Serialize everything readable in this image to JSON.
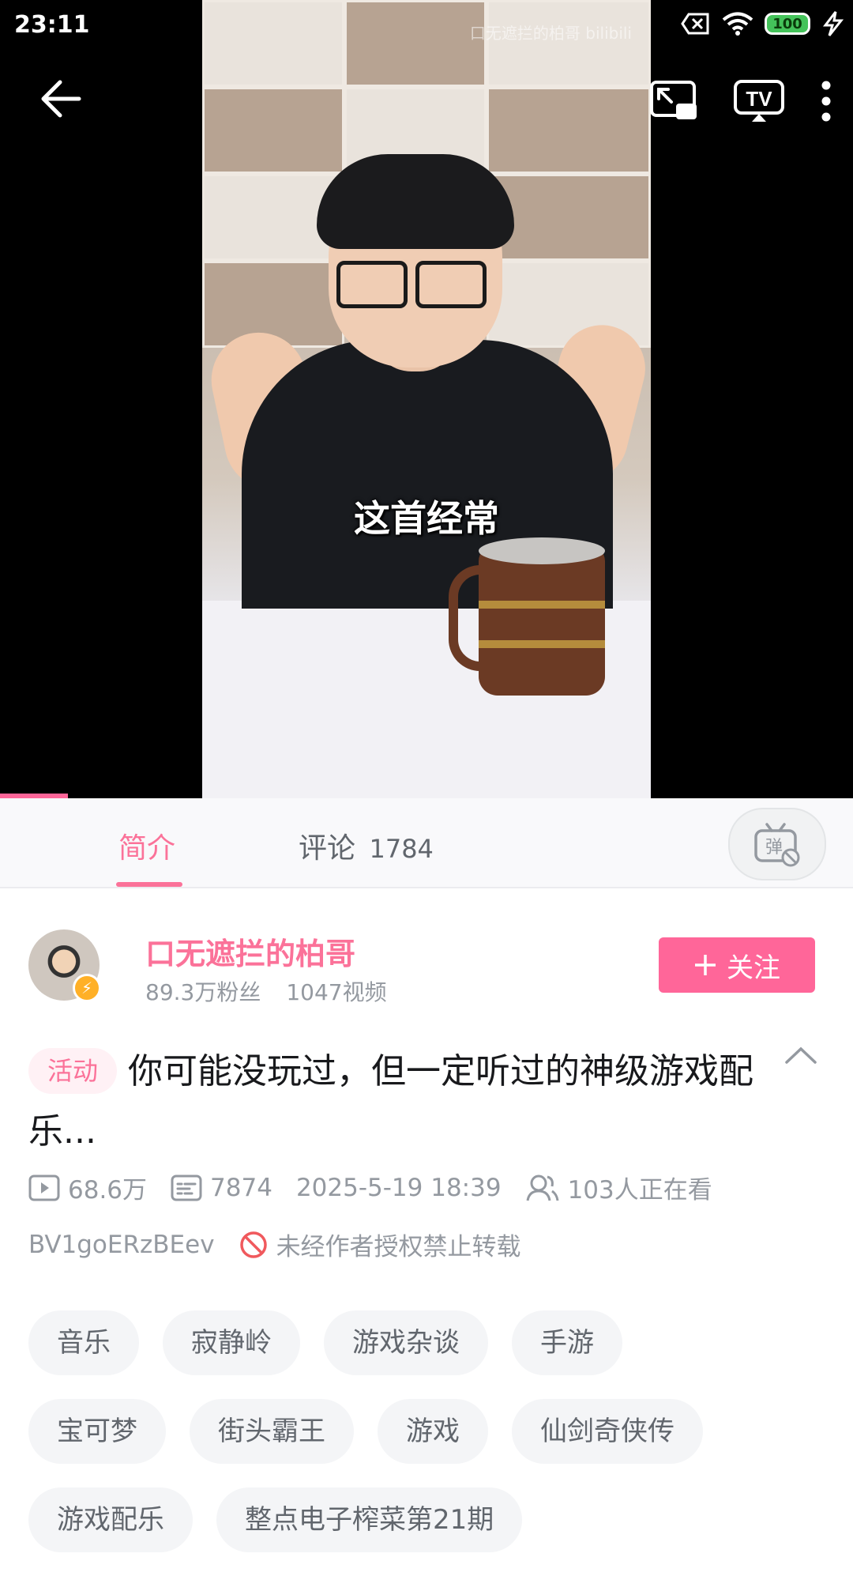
{
  "status_bar": {
    "time": "23:11",
    "battery": "100"
  },
  "video": {
    "caption": "这首经常",
    "watermark": "口无遮拦的柏哥 bilibili",
    "progress_fraction": 0.08
  },
  "tabs": [
    {
      "label": "简介",
      "active": true
    },
    {
      "label": "评论",
      "count": "1784",
      "active": false
    }
  ],
  "uploader": {
    "name": "口无遮拦的柏哥",
    "fans": "89.3万粉丝",
    "videos": "1047视频",
    "follow_label": "关注"
  },
  "video_info": {
    "activity_tag": "活动",
    "title": "你可能没玩过，但一定听过的神级游戏配乐...",
    "plays": "68.6万",
    "danmaku": "7874",
    "date": "2025-5-19 18:39",
    "watching": "103人正在看",
    "bvid": "BV1goERzBEev",
    "copyright": "未经作者授权禁止转载"
  },
  "tags": [
    [
      "音乐",
      "寂静岭",
      "游戏杂谈",
      "手游"
    ],
    [
      "宝可梦",
      "街头霸王",
      "游戏",
      "仙剑奇侠传"
    ],
    [
      "游戏配乐",
      "整点电子榨菜第21期"
    ]
  ],
  "colors": {
    "accent": "#fb7299",
    "follow": "#ff6699"
  }
}
